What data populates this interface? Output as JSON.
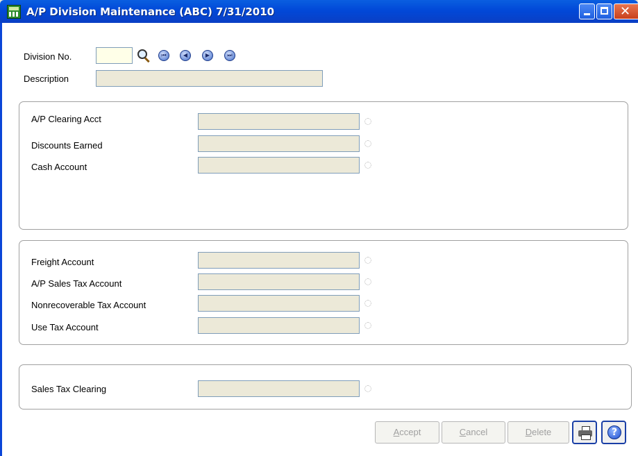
{
  "window": {
    "title": "A/P Division Maintenance (ABC) 7/31/2010"
  },
  "header": {
    "division_no_label": "Division No.",
    "division_no_value": "",
    "description_label": "Description",
    "description_value": ""
  },
  "icons": {
    "app": "app-icon",
    "search": "search-icon",
    "nav_first": "first-record-icon",
    "nav_prev": "previous-record-icon",
    "nav_next": "next-record-icon",
    "nav_last": "last-record-icon",
    "print": "printer-icon",
    "help": "help-icon"
  },
  "group1": {
    "ap_clearing_label": "A/P Clearing Acct",
    "discounts_label": "Discounts Earned",
    "cash_label": "Cash Account"
  },
  "group2": {
    "freight_label": "Freight Account",
    "sales_tax_label": "A/P Sales Tax Account",
    "nonrecoverable_label": "Nonrecoverable Tax Account",
    "use_tax_label": "Use Tax Account"
  },
  "group3": {
    "sales_tax_clearing_label": "Sales Tax Clearing"
  },
  "buttons": {
    "accept_u": "A",
    "accept_rest": "ccept",
    "cancel_u": "C",
    "cancel_rest": "ancel",
    "delete_u": "D",
    "delete_rest": "elete"
  },
  "colors": {
    "titlebar": "#0148d8",
    "disabled_text": "#a0a0a0",
    "field_bg": "#ece9d8"
  }
}
